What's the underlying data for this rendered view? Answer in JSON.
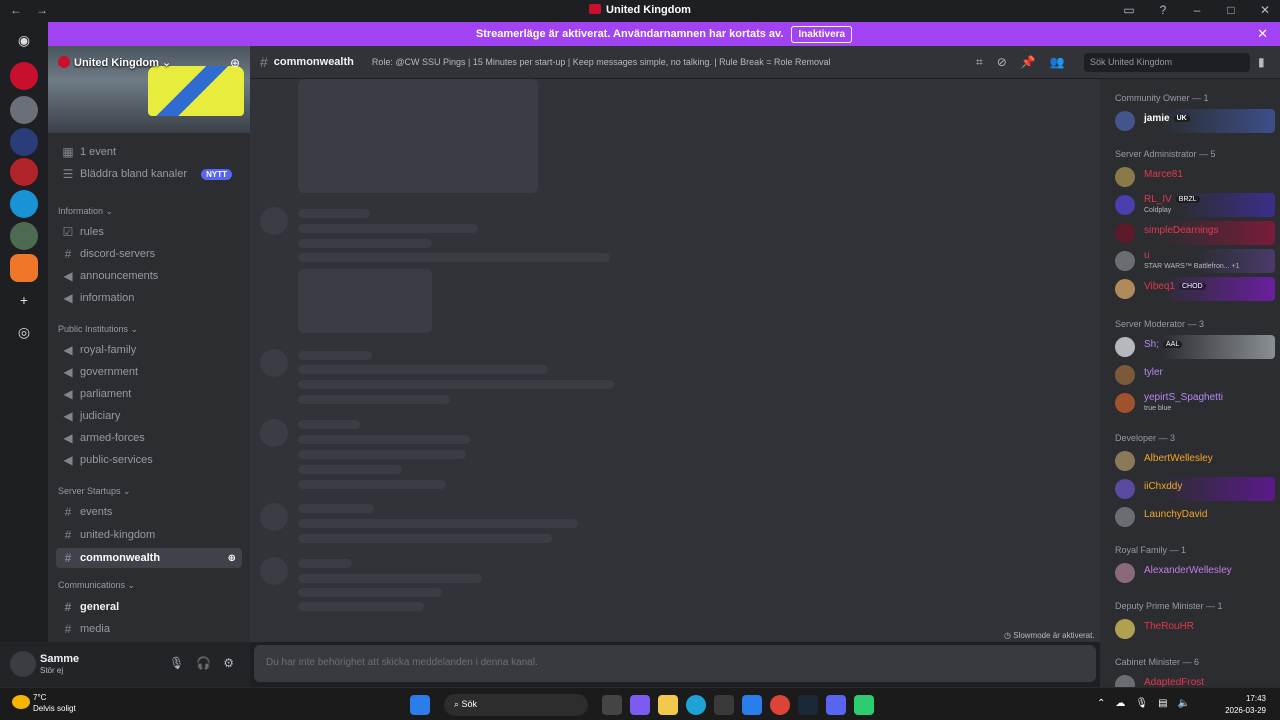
{
  "window": {
    "title": "United Kingdom",
    "nav_back": "←",
    "nav_forward": "→",
    "controls": [
      "▭",
      "?",
      "–",
      "□",
      "✕"
    ]
  },
  "banner": {
    "text": "Streamerläge är aktiverat. Användarnamnen har kortats av.",
    "button": "Inaktivera",
    "close": "✕"
  },
  "guilds": {
    "home_icon": "discord-icon",
    "add_label": "+",
    "explore_label": "◎"
  },
  "server": {
    "name": "United Kingdom",
    "chevron": "⌄",
    "invite_icon": "person-add-icon",
    "events": "1 event",
    "browse": "Bläddra bland kanaler",
    "browse_badge": "NYTT"
  },
  "categories": {
    "information": "Information",
    "public_institutions": "Public Institutions",
    "server_startups": "Server Startups",
    "communications": "Communications"
  },
  "channels": {
    "rules": "rules",
    "discord_servers": "discord-servers",
    "announcements": "announcements",
    "information": "information",
    "royal_family": "royal-family",
    "government": "government",
    "parliament": "parliament",
    "judiciary": "judiciary",
    "armed_forces": "armed-forces",
    "public_services": "public-services",
    "events": "events",
    "united_kingdom": "united-kingdom",
    "commonwealth": "commonwealth",
    "general": "general",
    "media": "media"
  },
  "user": {
    "name": "Samme",
    "status": "Stör ej"
  },
  "header": {
    "channel": "commonwealth",
    "topic": "Role: @CW SSU Pings | 15 Minutes per start-up | Keep messages simple, no talking. | Rule Break = Role Removal",
    "search_placeholder": "Sök United Kingdom"
  },
  "chat": {
    "slowmode": "Slowmode är aktiverat.",
    "composer": "Du har inte behörighet att skicka meddelanden i denna kanal."
  },
  "members": {
    "community_owner": "Community Owner — 1",
    "server_admin": "Server Administrator — 5",
    "server_moderator": "Server Moderator — 3",
    "developer": "Developer — 3",
    "royal_family": "Royal Family — 1",
    "deputy_pm": "Deputy Prime Minister — 1",
    "cabinet_minister": "Cabinet Minister — 6",
    "list": {
      "jamie": "jamie",
      "jamie_tag": "UK",
      "marcel": "Marce81",
      "rl_iv": "RL_IV",
      "rl_iv_tag": "BRZL",
      "rl_iv_sub": "Coldplay",
      "simple": "simpleDearnings",
      "u": "u",
      "u_sub": "STAR WARS™ Battlefron... +1",
      "vibes": "Vibeq1",
      "vibes_tag": "CHOD",
      "sh": "Sh;",
      "sh_tag": "AAL",
      "tyler": "tyler",
      "yepirts": "yepirtS_Spaghetti",
      "yepirts_sub": "true blue",
      "albert": "AlbertWellesley",
      "iichxddy": "iiChxddy",
      "launchy": "LaunchyDavid",
      "alexander": "AlexanderWellesley",
      "therou": "TheRouHR",
      "adapted": "AdaptedFrost"
    }
  },
  "taskbar": {
    "temp": "7°C",
    "weather": "Delvis soligt",
    "search": "Sök",
    "time": "17:43",
    "date": "2026-03-29",
    "tray_up": "⌃"
  }
}
